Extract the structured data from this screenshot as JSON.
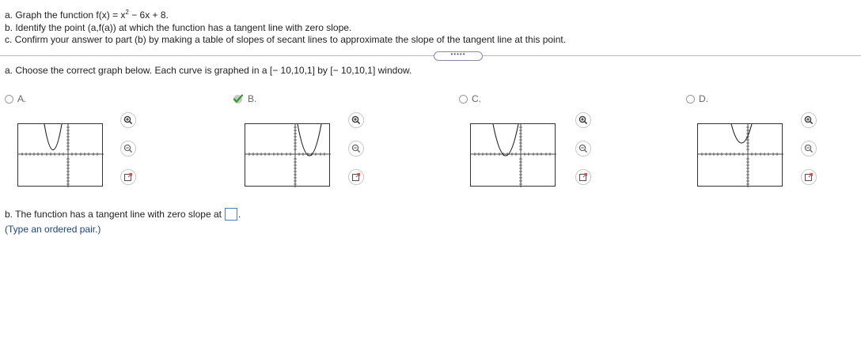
{
  "question": {
    "part_a_prefix": "a. Graph the function f(x) = x",
    "part_a_exponent": "2",
    "part_a_suffix": " − 6x + 8.",
    "part_b": "b. Identify the point (a,f(a)) at which the function has a tangent line with zero slope.",
    "part_c": "c. Confirm your answer to part (b) by making a table of slopes of secant lines to approximate the slope of the tangent line at this point."
  },
  "expand_pill_label": "•••••",
  "part_a_instruction": "a. Choose the correct graph below. Each curve is graphed in a [− 10,10,1] by [− 10,10,1] window.",
  "options": [
    {
      "label": "A.",
      "selected": false
    },
    {
      "label": "B.",
      "selected": true
    },
    {
      "label": "C.",
      "selected": false
    },
    {
      "label": "D.",
      "selected": false
    }
  ],
  "correct_mark_color": "#2e9b2e",
  "tool_icons": [
    "zoom-in-icon",
    "zoom-out-icon",
    "open-external-icon"
  ],
  "part_b_answer": {
    "prompt": "b. The function has a tangent line with zero slope at",
    "value": "",
    "period": ".",
    "hint": "(Type an ordered pair.)"
  }
}
